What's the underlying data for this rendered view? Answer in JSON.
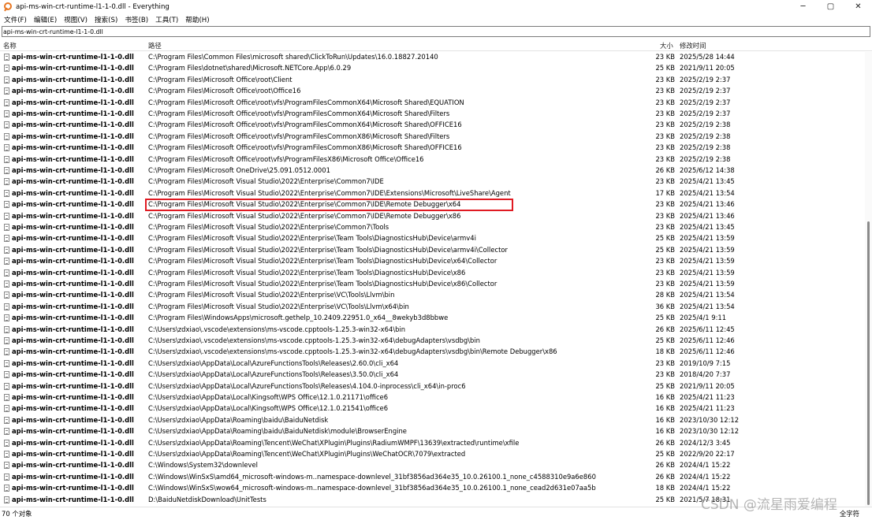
{
  "window": {
    "title": "api-ms-win-crt-runtime-l1-1-0.dll - Everything",
    "app_icon": "magnifier-icon",
    "minimize": "─",
    "maximize": "▢",
    "close": "✕"
  },
  "menu": [
    "文件(F)",
    "编辑(E)",
    "视图(V)",
    "搜索(S)",
    "书签(B)",
    "工具(T)",
    "帮助(H)"
  ],
  "search": {
    "value": "api-ms-win-crt-runtime-l1-1-0.dll"
  },
  "columns": {
    "name": "名称",
    "path": "路径",
    "size": "大小",
    "modified": "修改时间"
  },
  "rows": [
    {
      "name": "api-ms-win-crt-runtime-l1-1-0.dll",
      "path": "C:\\Program Files\\Common Files\\microsoft shared\\ClickToRun\\Updates\\16.0.18827.20140",
      "size": "23 KB",
      "modified": "2025/5/28 14:44"
    },
    {
      "name": "api-ms-win-crt-runtime-l1-1-0.dll",
      "path": "C:\\Program Files\\dotnet\\shared\\Microsoft.NETCore.App\\6.0.29",
      "size": "25 KB",
      "modified": "2021/9/11 20:05"
    },
    {
      "name": "api-ms-win-crt-runtime-l1-1-0.dll",
      "path": "C:\\Program Files\\Microsoft Office\\root\\Client",
      "size": "23 KB",
      "modified": "2025/2/19 2:37"
    },
    {
      "name": "api-ms-win-crt-runtime-l1-1-0.dll",
      "path": "C:\\Program Files\\Microsoft Office\\root\\Office16",
      "size": "23 KB",
      "modified": "2025/2/19 2:37"
    },
    {
      "name": "api-ms-win-crt-runtime-l1-1-0.dll",
      "path": "C:\\Program Files\\Microsoft Office\\root\\vfs\\ProgramFilesCommonX64\\Microsoft Shared\\EQUATION",
      "size": "23 KB",
      "modified": "2025/2/19 2:37"
    },
    {
      "name": "api-ms-win-crt-runtime-l1-1-0.dll",
      "path": "C:\\Program Files\\Microsoft Office\\root\\vfs\\ProgramFilesCommonX64\\Microsoft Shared\\Filters",
      "size": "23 KB",
      "modified": "2025/2/19 2:37"
    },
    {
      "name": "api-ms-win-crt-runtime-l1-1-0.dll",
      "path": "C:\\Program Files\\Microsoft Office\\root\\vfs\\ProgramFilesCommonX64\\Microsoft Shared\\OFFICE16",
      "size": "23 KB",
      "modified": "2025/2/19 2:38"
    },
    {
      "name": "api-ms-win-crt-runtime-l1-1-0.dll",
      "path": "C:\\Program Files\\Microsoft Office\\root\\vfs\\ProgramFilesCommonX86\\Microsoft Shared\\Filters",
      "size": "23 KB",
      "modified": "2025/2/19 2:38"
    },
    {
      "name": "api-ms-win-crt-runtime-l1-1-0.dll",
      "path": "C:\\Program Files\\Microsoft Office\\root\\vfs\\ProgramFilesCommonX86\\Microsoft Shared\\OFFICE16",
      "size": "23 KB",
      "modified": "2025/2/19 2:38"
    },
    {
      "name": "api-ms-win-crt-runtime-l1-1-0.dll",
      "path": "C:\\Program Files\\Microsoft Office\\root\\vfs\\ProgramFilesX86\\Microsoft Office\\Office16",
      "size": "23 KB",
      "modified": "2025/2/19 2:38"
    },
    {
      "name": "api-ms-win-crt-runtime-l1-1-0.dll",
      "path": "C:\\Program Files\\Microsoft OneDrive\\25.091.0512.0001",
      "size": "26 KB",
      "modified": "2025/6/12 14:38"
    },
    {
      "name": "api-ms-win-crt-runtime-l1-1-0.dll",
      "path": "C:\\Program Files\\Microsoft Visual Studio\\2022\\Enterprise\\Common7\\IDE",
      "size": "23 KB",
      "modified": "2025/4/21 13:45"
    },
    {
      "name": "api-ms-win-crt-runtime-l1-1-0.dll",
      "path": "C:\\Program Files\\Microsoft Visual Studio\\2022\\Enterprise\\Common7\\IDE\\Extensions\\Microsoft\\LiveShare\\Agent",
      "size": "17 KB",
      "modified": "2025/4/21 13:54"
    },
    {
      "name": "api-ms-win-crt-runtime-l1-1-0.dll",
      "path": "C:\\Program Files\\Microsoft Visual Studio\\2022\\Enterprise\\Common7\\IDE\\Remote Debugger\\x64",
      "size": "23 KB",
      "modified": "2025/4/21 13:46"
    },
    {
      "name": "api-ms-win-crt-runtime-l1-1-0.dll",
      "path": "C:\\Program Files\\Microsoft Visual Studio\\2022\\Enterprise\\Common7\\IDE\\Remote Debugger\\x86",
      "size": "23 KB",
      "modified": "2025/4/21 13:46"
    },
    {
      "name": "api-ms-win-crt-runtime-l1-1-0.dll",
      "path": "C:\\Program Files\\Microsoft Visual Studio\\2022\\Enterprise\\Common7\\Tools",
      "size": "23 KB",
      "modified": "2025/4/21 13:45"
    },
    {
      "name": "api-ms-win-crt-runtime-l1-1-0.dll",
      "path": "C:\\Program Files\\Microsoft Visual Studio\\2022\\Enterprise\\Team Tools\\DiagnosticsHub\\Device\\armv4i",
      "size": "25 KB",
      "modified": "2025/4/21 13:59"
    },
    {
      "name": "api-ms-win-crt-runtime-l1-1-0.dll",
      "path": "C:\\Program Files\\Microsoft Visual Studio\\2022\\Enterprise\\Team Tools\\DiagnosticsHub\\Device\\armv4i\\Collector",
      "size": "25 KB",
      "modified": "2025/4/21 13:59"
    },
    {
      "name": "api-ms-win-crt-runtime-l1-1-0.dll",
      "path": "C:\\Program Files\\Microsoft Visual Studio\\2022\\Enterprise\\Team Tools\\DiagnosticsHub\\Device\\x64\\Collector",
      "size": "23 KB",
      "modified": "2025/4/21 13:59"
    },
    {
      "name": "api-ms-win-crt-runtime-l1-1-0.dll",
      "path": "C:\\Program Files\\Microsoft Visual Studio\\2022\\Enterprise\\Team Tools\\DiagnosticsHub\\Device\\x86",
      "size": "23 KB",
      "modified": "2025/4/21 13:59"
    },
    {
      "name": "api-ms-win-crt-runtime-l1-1-0.dll",
      "path": "C:\\Program Files\\Microsoft Visual Studio\\2022\\Enterprise\\Team Tools\\DiagnosticsHub\\Device\\x86\\Collector",
      "size": "23 KB",
      "modified": "2025/4/21 13:59"
    },
    {
      "name": "api-ms-win-crt-runtime-l1-1-0.dll",
      "path": "C:\\Program Files\\Microsoft Visual Studio\\2022\\Enterprise\\VC\\Tools\\Llvm\\bin",
      "size": "28 KB",
      "modified": "2025/4/21 13:54"
    },
    {
      "name": "api-ms-win-crt-runtime-l1-1-0.dll",
      "path": "C:\\Program Files\\Microsoft Visual Studio\\2022\\Enterprise\\VC\\Tools\\Llvm\\x64\\bin",
      "size": "36 KB",
      "modified": "2025/4/21 13:54"
    },
    {
      "name": "api-ms-win-crt-runtime-l1-1-0.dll",
      "path": "C:\\Program Files\\WindowsApps\\microsoft.gethelp_10.2409.22951.0_x64__8wekyb3d8bbwe",
      "size": "25 KB",
      "modified": "2025/4/1 9:11"
    },
    {
      "name": "api-ms-win-crt-runtime-l1-1-0.dll",
      "path": "C:\\Users\\zdxiao\\.vscode\\extensions\\ms-vscode.cpptools-1.25.3-win32-x64\\bin",
      "size": "26 KB",
      "modified": "2025/6/11 12:45"
    },
    {
      "name": "api-ms-win-crt-runtime-l1-1-0.dll",
      "path": "C:\\Users\\zdxiao\\.vscode\\extensions\\ms-vscode.cpptools-1.25.3-win32-x64\\debugAdapters\\vsdbg\\bin",
      "size": "25 KB",
      "modified": "2025/6/11 12:46"
    },
    {
      "name": "api-ms-win-crt-runtime-l1-1-0.dll",
      "path": "C:\\Users\\zdxiao\\.vscode\\extensions\\ms-vscode.cpptools-1.25.3-win32-x64\\debugAdapters\\vsdbg\\bin\\Remote Debugger\\x86",
      "size": "18 KB",
      "modified": "2025/6/11 12:46"
    },
    {
      "name": "api-ms-win-crt-runtime-l1-1-0.dll",
      "path": "C:\\Users\\zdxiao\\AppData\\Local\\AzureFunctionsTools\\Releases\\2.60.0\\cli_x64",
      "size": "23 KB",
      "modified": "2019/10/9 7:15"
    },
    {
      "name": "api-ms-win-crt-runtime-l1-1-0.dll",
      "path": "C:\\Users\\zdxiao\\AppData\\Local\\AzureFunctionsTools\\Releases\\3.50.0\\cli_x64",
      "size": "23 KB",
      "modified": "2018/4/20 7:37"
    },
    {
      "name": "api-ms-win-crt-runtime-l1-1-0.dll",
      "path": "C:\\Users\\zdxiao\\AppData\\Local\\AzureFunctionsTools\\Releases\\4.104.0-inprocess\\cli_x64\\in-proc6",
      "size": "25 KB",
      "modified": "2021/9/11 20:05"
    },
    {
      "name": "api-ms-win-crt-runtime-l1-1-0.dll",
      "path": "C:\\Users\\zdxiao\\AppData\\Local\\Kingsoft\\WPS Office\\12.1.0.21171\\office6",
      "size": "16 KB",
      "modified": "2025/4/21 11:23"
    },
    {
      "name": "api-ms-win-crt-runtime-l1-1-0.dll",
      "path": "C:\\Users\\zdxiao\\AppData\\Local\\Kingsoft\\WPS Office\\12.1.0.21541\\office6",
      "size": "16 KB",
      "modified": "2025/4/21 11:23"
    },
    {
      "name": "api-ms-win-crt-runtime-l1-1-0.dll",
      "path": "C:\\Users\\zdxiao\\AppData\\Roaming\\baidu\\BaiduNetdisk",
      "size": "16 KB",
      "modified": "2023/10/30 12:12"
    },
    {
      "name": "api-ms-win-crt-runtime-l1-1-0.dll",
      "path": "C:\\Users\\zdxiao\\AppData\\Roaming\\baidu\\BaiduNetdisk\\module\\BrowserEngine",
      "size": "16 KB",
      "modified": "2023/10/30 12:12"
    },
    {
      "name": "api-ms-win-crt-runtime-l1-1-0.dll",
      "path": "C:\\Users\\zdxiao\\AppData\\Roaming\\Tencent\\WeChat\\XPlugin\\Plugins\\RadiumWMPF\\13639\\extracted\\runtime\\xfile",
      "size": "26 KB",
      "modified": "2024/12/3 3:45"
    },
    {
      "name": "api-ms-win-crt-runtime-l1-1-0.dll",
      "path": "C:\\Users\\zdxiao\\AppData\\Roaming\\Tencent\\WeChat\\XPlugin\\Plugins\\WeChatOCR\\7079\\extracted",
      "size": "25 KB",
      "modified": "2022/9/20 22:17"
    },
    {
      "name": "api-ms-win-crt-runtime-l1-1-0.dll",
      "path": "C:\\Windows\\System32\\downlevel",
      "size": "26 KB",
      "modified": "2024/4/1 15:22"
    },
    {
      "name": "api-ms-win-crt-runtime-l1-1-0.dll",
      "path": "C:\\Windows\\WinSxS\\amd64_microsoft-windows-m..namespace-downlevel_31bf3856ad364e35_10.0.26100.1_none_c4588310e9a6e860",
      "size": "26 KB",
      "modified": "2024/4/1 15:22"
    },
    {
      "name": "api-ms-win-crt-runtime-l1-1-0.dll",
      "path": "C:\\Windows\\WinSxS\\wow64_microsoft-windows-m..namespace-downlevel_31bf3856ad364e35_10.0.26100.1_none_cead2d631e07aa5b",
      "size": "18 KB",
      "modified": "2024/4/1 15:22"
    },
    {
      "name": "api-ms-win-crt-runtime-l1-1-0.dll",
      "path": "D:\\BaiduNetdiskDownload\\UnitTests",
      "size": "25 KB",
      "modified": "2021/5/7 18:31"
    }
  ],
  "status": {
    "count": "70 个对象",
    "right": "全字符"
  },
  "watermark": "CSDN @流星雨爱编程",
  "colors": {
    "highlight_border": "#e01a22",
    "app_icon": "#e87722"
  }
}
